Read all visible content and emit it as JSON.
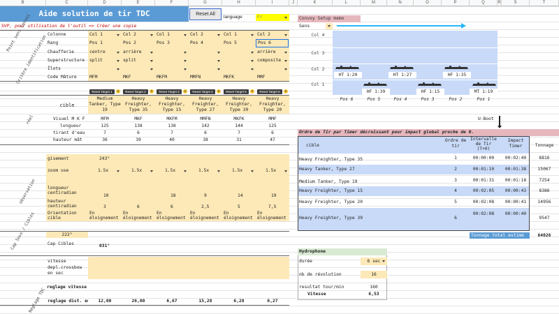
{
  "columns": [
    "B",
    "C",
    "D",
    "E",
    "F",
    "G",
    "H",
    "I",
    "J",
    "K",
    "L",
    "M",
    "N",
    "O",
    "P",
    "Q",
    "R",
    "S",
    "T"
  ],
  "title": "Aide solution de tir TDC",
  "reset_all": "Reset All",
  "language_label": "language",
  "language_value": "Fr",
  "copy_note": "SVP, pour utilisation de l'outil => Créer une copie",
  "side_labels": {
    "point_sens": "Point sens Convoi",
    "critere": "Critère identification",
    "reel": "réel",
    "observation": "observation",
    "cap_cibles": "Cap Sous / Cibles",
    "reglage": "Réglage TDC"
  },
  "rows": {
    "colonne": "Colonne",
    "rang": "Rang",
    "chaufferie": "Chaufferie",
    "superstructure": "Superstructure",
    "ilots": "Îlots",
    "code_mature": "Code Mâture"
  },
  "colonne_vals": [
    "Col 1",
    "Col 2",
    "Col 1",
    "Col 2",
    "Col 1",
    "Col 2"
  ],
  "rang_vals": [
    "Pos 1",
    "Pos 2",
    "Pos 3",
    "Pos 4",
    "Pos 5",
    "Pos 6"
  ],
  "chaufferie_vals": [
    "centre",
    "arrière",
    "",
    "",
    "",
    "arrière"
  ],
  "superstructure_vals": [
    "split",
    "split",
    "",
    "",
    "",
    "composite"
  ],
  "code_mature_vals": [
    "MFM",
    "MKF",
    "MKFM",
    "MMFN",
    "MKFK",
    "MMF"
  ],
  "reset_targets": [
    "Reset Target 1",
    "Reset Target 2",
    "Reset Target 3",
    "Reset Target 4",
    "Reset Target 5",
    "Reset Target 6"
  ],
  "cible_label": "cible",
  "cible_vals": [
    "Medium Tanker, Type 19",
    "Heavy Freighter, Type 35",
    "Heavy Freighter, Type 15",
    "Heavy Freighter, Type 27",
    "Heavy Freighter, Type 39",
    "Heavy Freighter, Type 20"
  ],
  "visuel_label": "Visuel M K F",
  "visuel_vals": [
    "MFM",
    "MKF",
    "MKFM",
    "MMFN",
    "MKFK",
    "MMF"
  ],
  "longueur_label": "longueur",
  "longueur_vals": [
    "125",
    "138",
    "138",
    "142",
    "144",
    "125"
  ],
  "tirant_label": "tirant d'eau",
  "tirant_vals": [
    "7",
    "6",
    "7",
    "6",
    "7",
    "6"
  ],
  "hauteur_label": "hauteur mât",
  "hauteur_vals": [
    "36",
    "39",
    "40",
    "38",
    "31",
    "47"
  ],
  "gisement_label": "gisement",
  "gisement_val": "243°",
  "zoom_label": "zoom use",
  "zoom_vals": [
    "1.5x",
    "1.5x",
    "1.5x",
    "1.5x",
    "1.5x",
    "1.5x"
  ],
  "long_centi_label": "longueur centiradian",
  "long_centi_vals": [
    "10",
    "",
    "18",
    "9",
    "14",
    "19"
  ],
  "haut_centi_label": "hauteur centiradian",
  "haut_centi_vals": [
    "3",
    "6",
    "6",
    "2,5",
    "5",
    "7,5"
  ],
  "orient_label": "Orientation cible",
  "orient_vals": [
    "En éloignement",
    "En éloignement",
    "En éloignement",
    "En éloignement",
    "En éloignement",
    "En éloignement"
  ],
  "cap_sous_val": "222°",
  "cap_cibles_label": "Cap Cibles",
  "cap_cibles_val": "031°",
  "vitesse_label": "vitesse",
  "depl_label": "depl.crossbow en sec",
  "reglage_vitesse_label": "reglage vitesse",
  "reglage_dist_label": "reglage dist. en",
  "reglage_dist_vals": [
    "12,00",
    "26,00",
    "6,67",
    "15,28",
    "6,28",
    "6,27"
  ],
  "convoy_title": "Convoy Setup memo",
  "sens_label": "Sens",
  "col_labels": [
    "Col 4",
    "Col 3",
    "Col 2",
    "Col 1"
  ],
  "pos_labels": [
    "Pos 6",
    "Pos 5",
    "Pos 4",
    "Pos 3",
    "Pos 2",
    "Pos 1"
  ],
  "ship_labels_col2": [
    "HT 1:20",
    "HT 1:27",
    "HF 1:35"
  ],
  "ship_labels_col1": [
    "HF 1:39",
    "HF 1:15",
    "MT 1:19"
  ],
  "uboot_label": "U-Boot",
  "order_title": "Ordre de Tir par Timer décroissant pour impact global proche de 0.",
  "order_headers": [
    "cible",
    "Ordre de tir",
    "Intervalle de Tir (T+0)",
    "Impact Timer",
    "Tonnage"
  ],
  "order_rows": [
    [
      "Heavy Freighter, Type 35",
      "1",
      "00:00:00",
      "00:02:40",
      "8816"
    ],
    [
      "Heavy Tanker, Type 27",
      "2",
      "00:01:10",
      "00:01:38",
      "15067"
    ],
    [
      "Medium Tanker, Type 19",
      "3",
      "00:01:31",
      "00:01:18",
      "7254"
    ],
    [
      "Heavy Freighter, Type 15",
      "4",
      "00:02:05",
      "00:00:43",
      "8386"
    ],
    [
      "Heavy Freighter, Type 20",
      "5",
      "00:02:08",
      "00:00:41",
      "14956"
    ],
    [
      "Heavy Freighter, Type 39",
      "6",
      "00:02:08",
      "00:00:40",
      "9547"
    ]
  ],
  "tonnage_label": "Tonnage total estimé",
  "tonnage_total": "64026",
  "hydro_title": "Hydrophone",
  "duree_label": "durée",
  "duree_val": "6 sec",
  "nb_rev_label": "nb de révolution",
  "nb_rev_val": "16",
  "resultat_label": "resultat tour/min",
  "resultat_val": "160",
  "vitesse_hydro_label": "Vitesse",
  "vitesse_hydro_val": "6,53",
  "colors": {
    "header_blue": "#5b9bd5",
    "yellow": "#fde9b7",
    "pink": "#e6b8be",
    "light_blue": "#c9daf8",
    "green": "#d9ead3"
  }
}
